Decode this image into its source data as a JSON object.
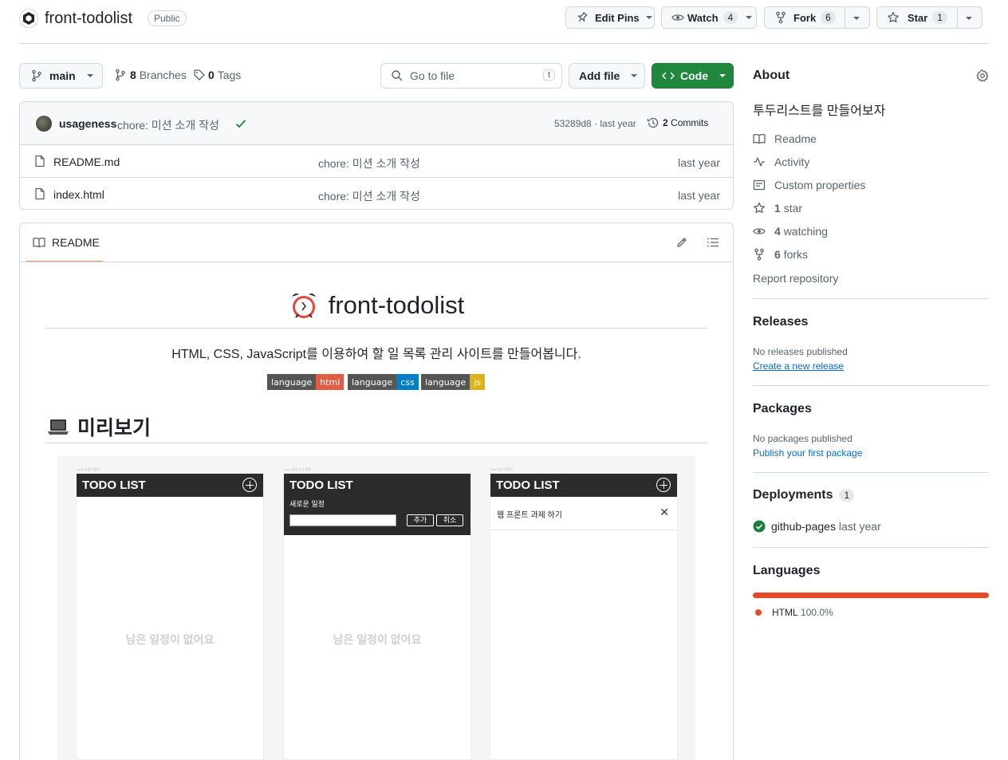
{
  "repo": {
    "name": "front-todolist",
    "visibility": "Public"
  },
  "actions": {
    "edit_pins": "Edit Pins",
    "watch": "Watch",
    "watch_count": "4",
    "fork": "Fork",
    "fork_count": "6",
    "star": "Star",
    "star_count": "1"
  },
  "toolbar": {
    "branch": "main",
    "branches_count": "8",
    "branches_label": "Branches",
    "tags_count": "0",
    "tags_label": "Tags",
    "goto_placeholder": "Go to file",
    "goto_key": "t",
    "add_file": "Add file",
    "code": "Code"
  },
  "commit": {
    "author": "usageness",
    "message": "chore: 미션 소개 작성",
    "hash_time": "53289d8 · last year",
    "commits_count": "2",
    "commits_label": "Commits"
  },
  "files": [
    {
      "name": "README.md",
      "message": "chore: 미션 소개 작성",
      "time": "last year"
    },
    {
      "name": "index.html",
      "message": "chore: 미션 소개 작성",
      "time": "last year"
    }
  ],
  "readme": {
    "tab": "README",
    "title": "front-todolist",
    "description": "HTML, CSS, JavaScript를 이용하여 할 일 목록 관리 사이트를 만들어봅니다.",
    "badges": [
      {
        "label": "language",
        "value": "html",
        "color": "#e05d44"
      },
      {
        "label": "language",
        "value": "css",
        "color": "#007ec6"
      },
      {
        "label": "language",
        "value": "js",
        "color": "#dfb317"
      }
    ],
    "preview_heading": "미리보기",
    "preview": {
      "app_title": "TODO LIST",
      "tiny_caption_1": "todo 일정 만들기",
      "tiny_caption_2": "todo 일정 추가 화면",
      "tiny_caption_3": "todo 일정 만들기",
      "empty_text": "남은 일정이 없어요",
      "new_label": "새로운 일정",
      "add_btn": "추가",
      "cancel_btn": "취소",
      "task": "웹 프론트 과제 하기"
    }
  },
  "about": {
    "heading": "About",
    "description": "투두리스트를 만들어보자",
    "readme": "Readme",
    "activity": "Activity",
    "custom_properties": "Custom properties",
    "stars_count": "1",
    "stars_label": "star",
    "watching_count": "4",
    "watching_label": "watching",
    "forks_count": "6",
    "forks_label": "forks",
    "report": "Report repository"
  },
  "releases": {
    "heading": "Releases",
    "none": "No releases published",
    "create": "Create a new release"
  },
  "packages": {
    "heading": "Packages",
    "none": "No packages published",
    "publish": "Publish your first package"
  },
  "deployments": {
    "heading": "Deployments",
    "count": "1",
    "name": "github-pages",
    "time": "last year"
  },
  "languages": {
    "heading": "Languages",
    "items": [
      {
        "name": "HTML",
        "percent": "100.0%",
        "color": "#e34c26"
      }
    ]
  },
  "colors": {
    "accent_green": "#1f883d",
    "link_blue": "#0969da",
    "underline_orange": "#fd8c73"
  }
}
